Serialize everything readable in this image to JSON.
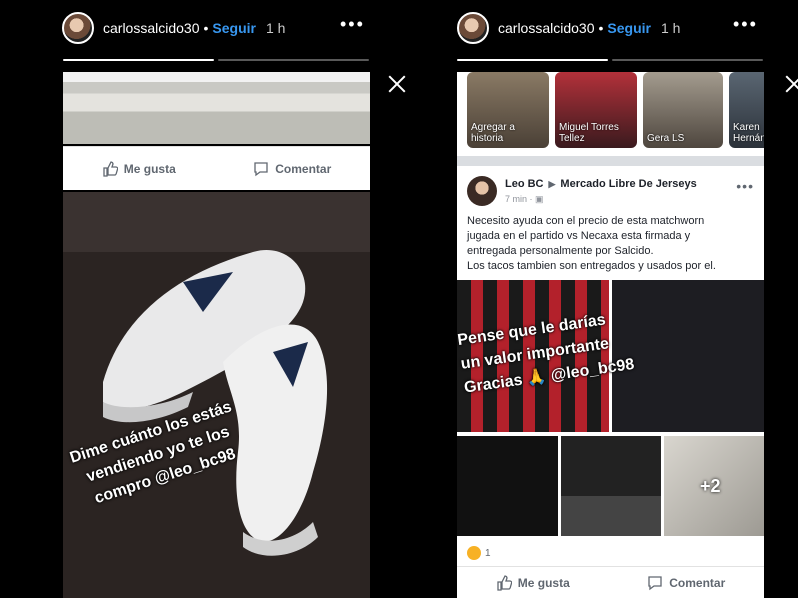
{
  "left_story": {
    "username": "carlossalcido30",
    "follow_label": "Seguir",
    "time": "1 h",
    "progress": [
      1.0,
      0.0
    ],
    "like_label": "Me gusta",
    "comment_label": "Comentar",
    "overlay_text": [
      "Dime cuánto los estás",
      "vendiendo yo te los",
      "compro @leo_bc98"
    ]
  },
  "right_story": {
    "username": "carlossalcido30",
    "follow_label": "Seguir",
    "time": "1 h",
    "progress": [
      1.0,
      0.0
    ],
    "stories": [
      {
        "caption": "Agregar a historia"
      },
      {
        "caption": "Miguel Torres Tellez"
      },
      {
        "caption": "Gera LS"
      },
      {
        "caption": "Karen Hernán"
      }
    ],
    "post": {
      "author": "Leo BC",
      "group": "Mercado Libre De Jerseys",
      "meta": "7 min · ▣",
      "body": [
        "Necesito ayuda con el precio de esta matchworn",
        "jugada en el partido vs Necaxa esta firmada y",
        "entregada personalmente por Salcido.",
        "Los tacos tambien son entregados y usados por el."
      ],
      "more_photos": "+2",
      "reaction_count": "1",
      "like_label": "Me gusta",
      "comment_label": "Comentar"
    },
    "overlay_text": [
      "Pense que le darías",
      "un valor importante",
      "Gracias 🙏 @leo_bc98"
    ]
  }
}
